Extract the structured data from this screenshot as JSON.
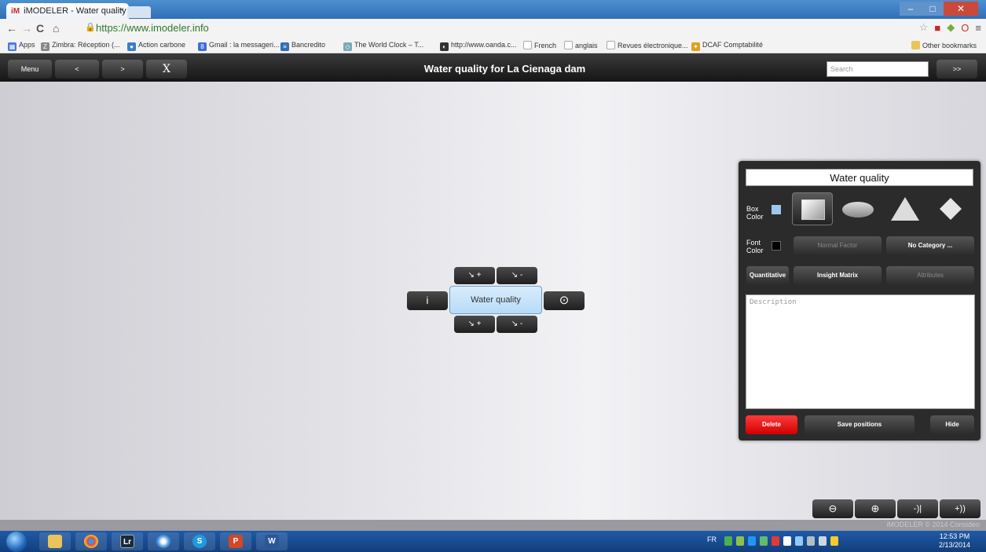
{
  "browser": {
    "tab_title": "iMODELER - Water quality",
    "tab_close": "×",
    "url": "https://www.imodeler.info",
    "bookmarks": [
      "Apps",
      "Zimbra: Réception (...",
      "Action carbone",
      "Gmail : la messageri...",
      "Bancredito",
      "The World Clock – T...",
      "http://www.oanda.c...",
      "French",
      "anglais",
      "Revues électronique...",
      "DCAF Comptabilité"
    ],
    "other_bookmarks": "Other bookmarks"
  },
  "toolbar": {
    "menu_label": "Menu",
    "back_label": "<",
    "forward_label": ">",
    "tools_label": "X",
    "title": "Water quality for La Cienaga dam",
    "search_placeholder": "Search",
    "go_label": ">>"
  },
  "node": {
    "label": "Water quality",
    "info_label": "i",
    "target_label": "⊙",
    "top_plus": "↘ +",
    "top_minus": "↘ -",
    "bottom_plus": "↘ +",
    "bottom_minus": "↘ -"
  },
  "panel": {
    "name_value": "Water quality",
    "box_color_label": "Box Color",
    "box_color": "#9cc8ee",
    "font_color_label": "Font Color",
    "font_color": "#000000",
    "factor_type": "Normal Factor",
    "category": "No Category ...",
    "quantitative": "Quantitative",
    "insight_matrix": "Insight Matrix",
    "attributes": "Attributes",
    "description_placeholder": "Description",
    "delete_label": "Delete",
    "save_positions_label": "Save positions",
    "hide_label": "Hide"
  },
  "zoom": {
    "zoom_out": "⊖",
    "zoom_in": "⊕",
    "spacing_less": "-)|",
    "spacing_more": "+))"
  },
  "footer": {
    "copyright": "iMODELER © 2014 Consideo"
  },
  "taskbar": {
    "apps": [
      "Explorer",
      "Chrome",
      "Lr",
      "Skype",
      "S",
      "P",
      "W"
    ],
    "lang": "FR",
    "time": "12:53 PM",
    "date": "2/13/2014"
  },
  "colors": {
    "accent_red": "#ff0000",
    "toolbar_dark": "#1a1a1a",
    "node_blue": "#b8dbf7"
  }
}
